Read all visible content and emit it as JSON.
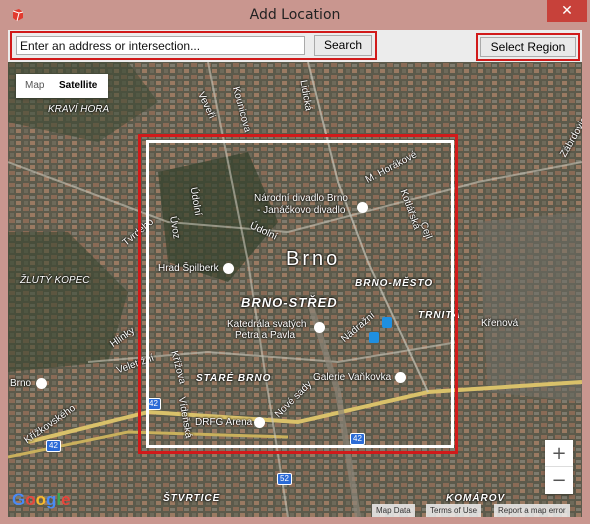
{
  "window": {
    "title": "Add Location",
    "close_glyph": "✕"
  },
  "toolbar": {
    "address_placeholder": "Enter an address or intersection...",
    "address_value": "",
    "search_label": "Search",
    "select_region_label": "Select Region"
  },
  "map": {
    "type_control": {
      "map_label": "Map",
      "satellite_label": "Satellite",
      "selected": "Satellite"
    },
    "labels": {
      "kravi_hora": "KRAVÍ HORA",
      "zluty_kopec": "ŽLUTÝ KOPEC",
      "brno_city": "Brno",
      "brno_stred": "BRNO-STŘED",
      "brno_mesto": "BRNO-MĚSTO",
      "stare_brno": "STARÉ BRNO",
      "trnita": "TRNITÁ",
      "stvrice": "ŠTVRTICE",
      "komarov": "KOMÁROV",
      "narodni_divadlo_1": "Národní divadlo Brno",
      "narodni_divadlo_2": "- Janáčkovo divadlo",
      "hrad_spilberk": "Hrad Špilberk",
      "katedrala_1": "Katedrála svatých",
      "katedrala_2": "Petra a Pavla",
      "galerie_vankovka": "Galerie Vaňkovka",
      "drfg_arena": "DRFG Arena",
      "brno_small": "Brno",
      "m_horakove": "M. Horákové",
      "kotlarska": "Kotlářská",
      "udolni_1": "Údolní",
      "udolni_2": "Údolní",
      "tvrdeho": "Tvrdého",
      "uvoz": "Úvoz",
      "hlinky": "Hlinky",
      "veletrzni": "Veletržní",
      "krizkovskeho": "Křížkovského",
      "kriova": "Křížova",
      "videnska": "Vídeňská",
      "nove_sady": "Nové sady",
      "nadrazni": "Nádražní",
      "krenova": "Křenová",
      "zabrdovice": "Zábrdovic",
      "kounicova": "Kounicova",
      "veveri": "Veveří",
      "lidicka": "Lidická",
      "cejl": "Cejl"
    },
    "shields": {
      "r42a": "42",
      "r42b": "42",
      "r42c": "42",
      "r52": "52"
    },
    "zoom": {
      "in": "+",
      "out": "−"
    },
    "attribution": {
      "map_data": "Map Data",
      "terms": "Terms of Use",
      "report": "Report a map error"
    },
    "logo": "Google"
  },
  "colors": {
    "selection_red": "#d11a1a",
    "title_bar": "#c9968f",
    "close": "#c7413a"
  }
}
